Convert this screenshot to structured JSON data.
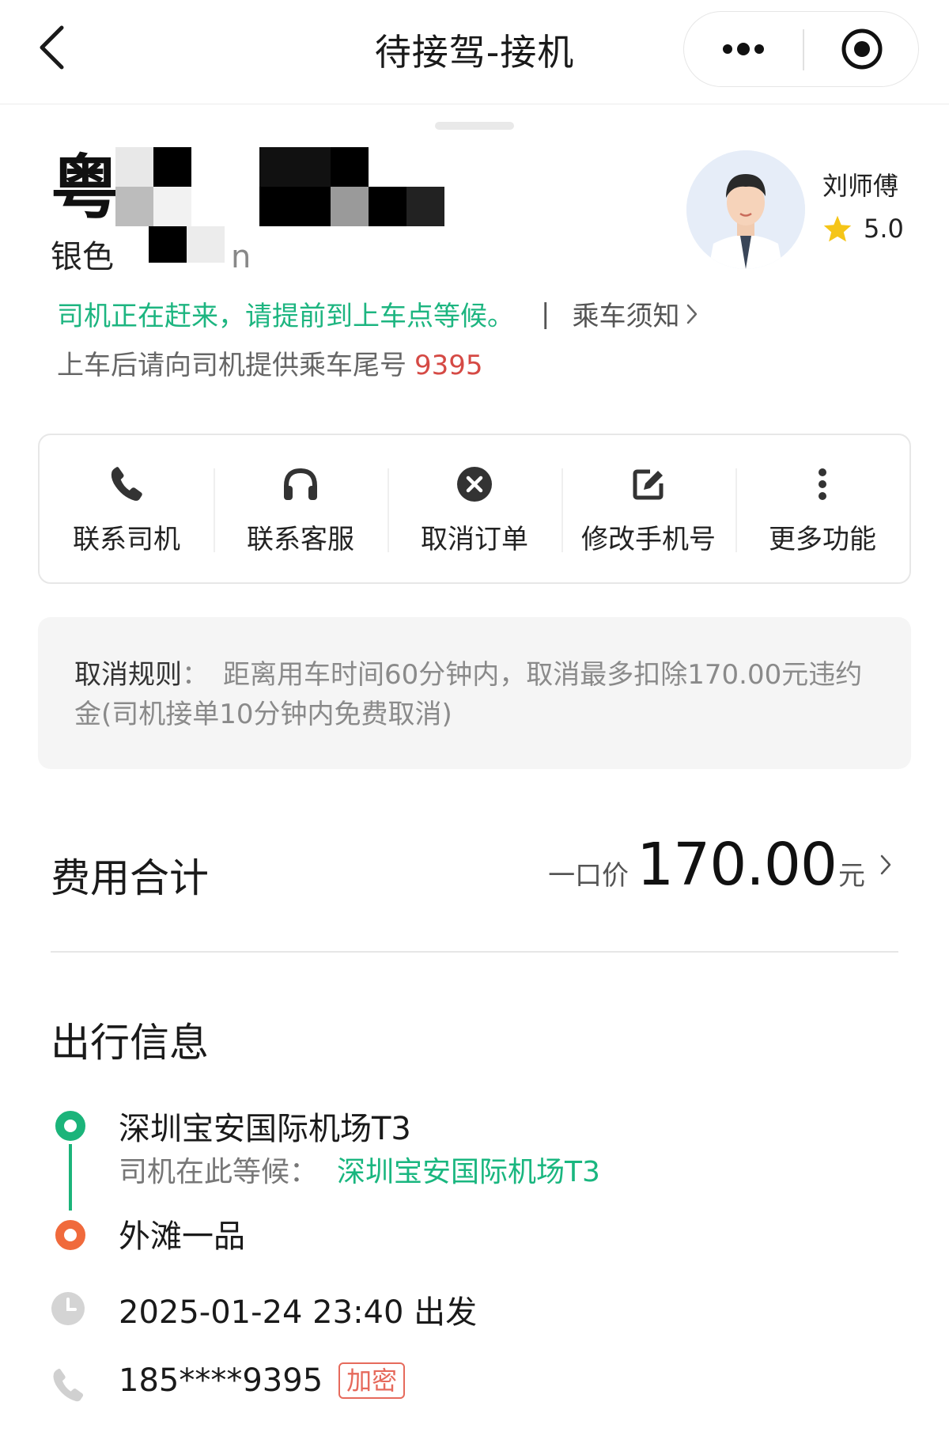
{
  "nav": {
    "title": "待接驾-接机",
    "back_icon": "chevron-left-icon",
    "more_icon": "more-dots-icon",
    "close_icon": "target-circle-icon"
  },
  "driver": {
    "plate_visible": "粤B",
    "car_desc_prefix": "银色",
    "car_desc_suffix": "n",
    "name": "刘师傅",
    "rating": "5.0",
    "status_text": "司机正在赶来，请提前到上车点等候。",
    "separator": "|",
    "notice_link": "乘车须知",
    "tail_hint": "上车后请向司机提供乘车尾号",
    "tail_number": "9395"
  },
  "actions": [
    {
      "label": "联系司机",
      "icon": "phone-icon"
    },
    {
      "label": "联系客服",
      "icon": "headset-icon"
    },
    {
      "label": "取消订单",
      "icon": "cancel-circle-icon"
    },
    {
      "label": "修改手机号",
      "icon": "edit-icon"
    },
    {
      "label": "更多功能",
      "icon": "more-vertical-icon"
    }
  ],
  "cancel_rules": {
    "title": "取消规则",
    "colon": "：",
    "text": "距离用车时间60分钟内，取消最多扣除170.00元违约金(司机接单10分钟内免费取消)"
  },
  "fee": {
    "title": "费用合计",
    "label": "一口价",
    "amount": "170.00",
    "unit": "元"
  },
  "trip": {
    "title": "出行信息",
    "start": "深圳宝安国际机场T3",
    "wait_label": "司机在此等候：",
    "wait_place": "深圳宝安国际机场T3",
    "end": "外滩一品",
    "time": "2025-01-24 23:40 出发",
    "phone": "185****9395",
    "phone_badge": "加密"
  },
  "colors": {
    "green": "#1bb47a",
    "orange": "#f06a3c",
    "red": "#d54a45",
    "star": "#f5c518"
  }
}
